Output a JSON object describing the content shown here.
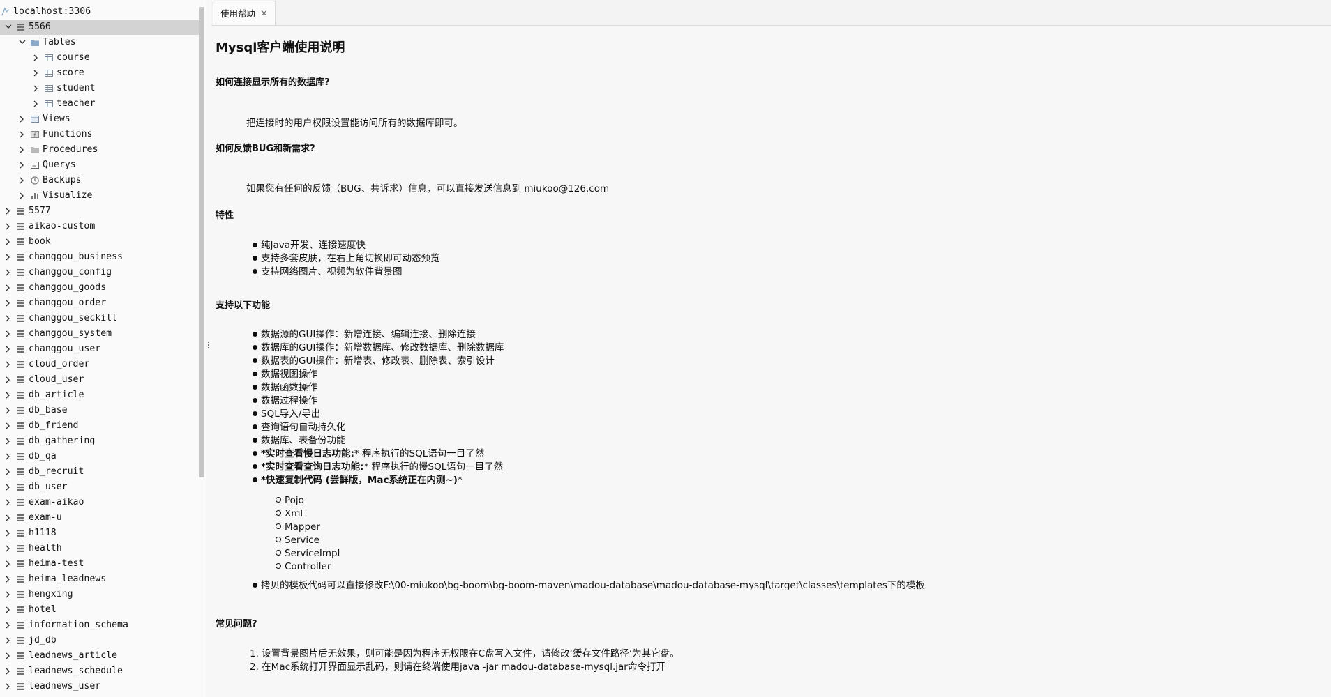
{
  "tree": {
    "connection": "localhost:3306",
    "expanded_db": "5566",
    "tables_folder": "Tables",
    "tables": [
      "course",
      "score",
      "student",
      "teacher"
    ],
    "folders": [
      "Views",
      "Functions",
      "Procedures",
      "Querys",
      "Backups",
      "Visualize"
    ],
    "databases": [
      "5577",
      "aikao-custom",
      "book",
      "changgou_business",
      "changgou_config",
      "changgou_goods",
      "changgou_order",
      "changgou_seckill",
      "changgou_system",
      "changgou_user",
      "cloud_order",
      "cloud_user",
      "db_article",
      "db_base",
      "db_friend",
      "db_gathering",
      "db_qa",
      "db_recruit",
      "db_user",
      "exam-aikao",
      "exam-u",
      "h1118",
      "health",
      "heima-test",
      "heima_leadnews",
      "hengxing",
      "hotel",
      "information_schema",
      "jd_db",
      "leadnews_article",
      "leadnews_schedule",
      "leadnews_user"
    ]
  },
  "tabs": [
    {
      "label": "使用帮助",
      "close": "×"
    }
  ],
  "doc": {
    "title": "Mysql客户端使用说明",
    "q1": "如何连接显示所有的数据库?",
    "a1": "把连接时的用户权限设置能访问所有的数据库即可。",
    "q2": "如何反馈BUG和新需求?",
    "a2": "如果您有任何的反馈（BUG、共诉求）信息，可以直接发送信息到 miukoo@126.com",
    "features_title": "特性",
    "features": [
      "纯Java开发、连接速度快",
      "支持多套皮肤，在右上角切换即可动态预览",
      "支持网络图片、视频为软件背景图"
    ],
    "functions_title": "支持以下功能",
    "functions": [
      "数据源的GUI操作：新增连接、编辑连接、删除连接",
      "数据库的GUI操作：新增数据库、修改数据库、删除数据库",
      "数据表的GUI操作：新增表、修改表、删除表、索引设计",
      "数据视图操作",
      "数据函数操作",
      "数据过程操作",
      "SQL导入/导出",
      "查询语句自动持久化",
      "数据库、表备份功能"
    ],
    "slowlog_bold": "*实时查看慢日志功能:",
    "slowlog_rest": "* 程序执行的SQL语句一目了然",
    "querylog_bold": "*实时查看查询日志功能:",
    "querylog_rest": "* 程序执行的慢SQL语句一目了然",
    "copycode_bold": "*快速复制代码 (尝鲜版，Mac系统正在内测~)",
    "copycode_rest": "*",
    "code_items": [
      "Pojo",
      "Xml",
      "Mapper",
      "Service",
      "ServiceImpl",
      "Controller"
    ],
    "template_note": "拷贝的模板代码可以直接修改F:\\00-miukoo\\bg-boom\\bg-boom-maven\\madou-database\\madou-database-mysql\\target\\classes\\templates下的模板",
    "faq_title": "常见问题?",
    "faq": [
      "1. 设置背景图片后无效果，则可能是因为程序无权限在C盘写入文件，请修改‘缓存文件路径’为其它盘。",
      "2. 在Mac系统打开界面显示乱码，则请在终端使用java -jar madou-database-mysql.jar命令打开"
    ]
  },
  "colors": {
    "selected_row": "#d3d3d3",
    "folder": "#8aa8c8",
    "background": "#f7f7f7"
  }
}
